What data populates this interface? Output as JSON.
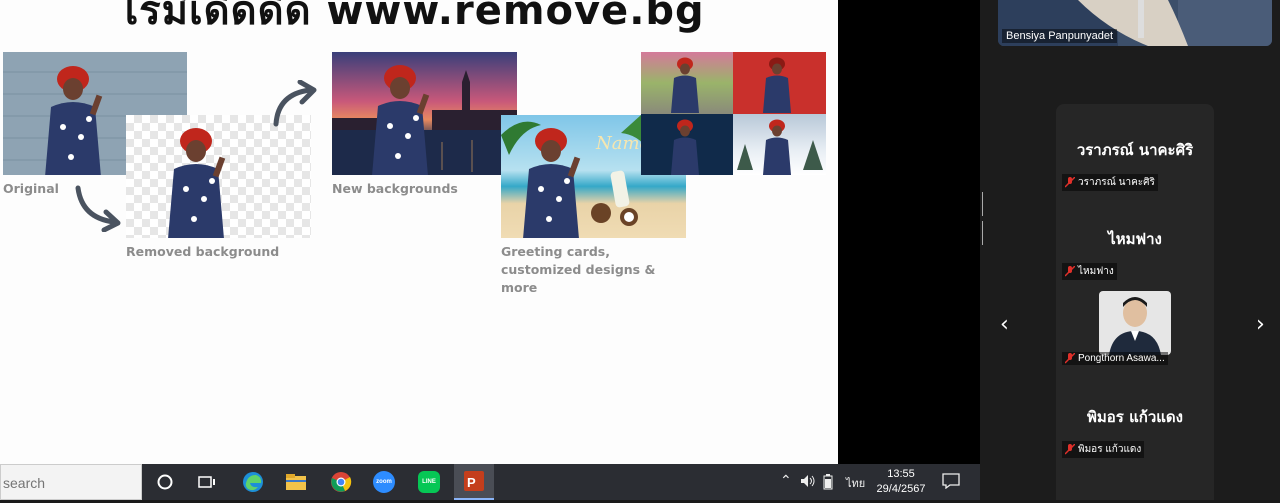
{
  "slide": {
    "title": "ไรมีเดิดดิด www.remove.bg",
    "captions": {
      "original": "Original",
      "removed": "Removed background",
      "new_bg": "New backgrounds",
      "greeting": "Greeting cards, customized designs & more"
    },
    "poster_text": "Name"
  },
  "zoom": {
    "top_participant": "Bensiya Panpunyadet",
    "participants": [
      {
        "display": "วราภรณ์ นาคะศิริ",
        "label": "วราภรณ์ นาคะศิริ"
      },
      {
        "display": "ไหมฟาง",
        "label": "ไหมฟาง"
      },
      {
        "display": "",
        "label": "Pongthorn Asawa..."
      },
      {
        "display": "พิมอร แก้วแดง",
        "label": "พิมอร แก้วแดง"
      }
    ],
    "prev": "‹",
    "next": "›"
  },
  "taskbar": {
    "search_placeholder": "search",
    "apps": [
      "cortana",
      "task-view",
      "edge",
      "file-explorer",
      "chrome",
      "zoom",
      "line",
      "powerpoint"
    ],
    "zoom_label": "zoom",
    "line_label": "LINE",
    "language": "ไทย",
    "time": "13:55",
    "date": "29/4/2567"
  },
  "colors": {
    "accent_ppt": "#c43e1c",
    "muted_mic": "#e0302a",
    "panel": "#262626"
  }
}
